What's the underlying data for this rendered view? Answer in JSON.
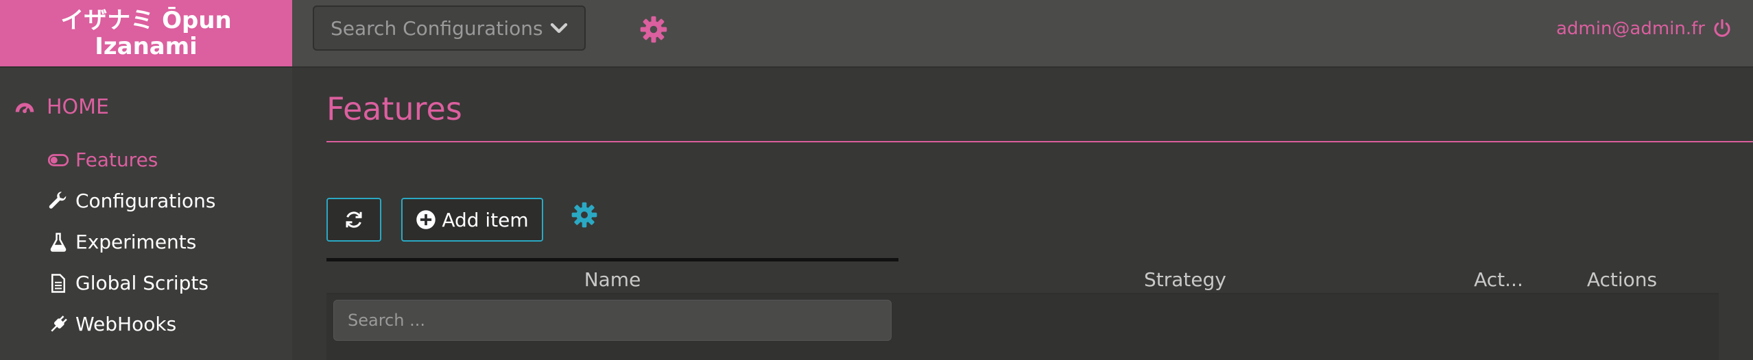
{
  "brand": {
    "line1": "イザナミ Ōpun",
    "line2": "Izanami"
  },
  "topbar": {
    "config_search_placeholder": "Search Configurations",
    "user_email": "admin@admin.fr"
  },
  "sidebar": {
    "home_label": "HOME",
    "items": [
      {
        "label": "Features",
        "icon": "toggle-icon",
        "active": true
      },
      {
        "label": "Configurations",
        "icon": "wrench-icon"
      },
      {
        "label": "Experiments",
        "icon": "flask-icon"
      },
      {
        "label": "Global Scripts",
        "icon": "file-icon"
      },
      {
        "label": "WebHooks",
        "icon": "plug-icon"
      }
    ]
  },
  "main": {
    "title": "Features",
    "add_item_label": "Add item",
    "table": {
      "columns": [
        "Name",
        "Strategy",
        "Act...",
        "Actions"
      ],
      "search_placeholder": "Search ..."
    }
  },
  "colors": {
    "accent": "#dc5f9f",
    "button_border": "#2aa9c4",
    "background": "#373735"
  }
}
